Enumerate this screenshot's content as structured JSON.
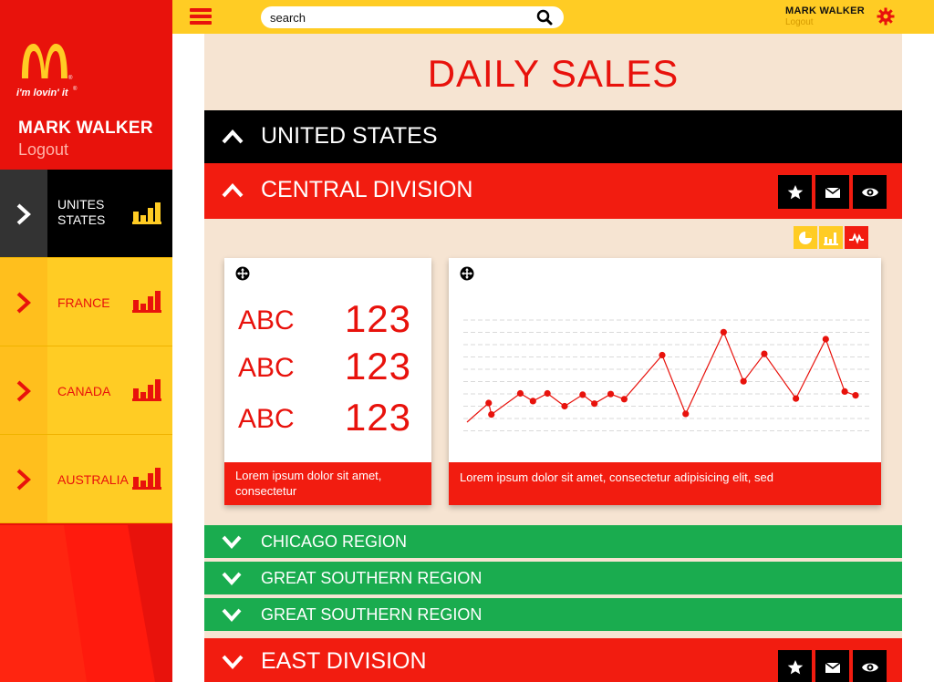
{
  "topbar": {
    "search_placeholder": "search",
    "user_name": "MARK WALKER",
    "logout": "Logout"
  },
  "sidebar": {
    "tagline": "i'm lovin' it®",
    "user_name": "MARK WALKER",
    "logout": "Logout",
    "items": [
      {
        "label_line1": "UNITES",
        "label_line2": "STATES",
        "active": true
      },
      {
        "label": "FRANCE"
      },
      {
        "label": "CANADA"
      },
      {
        "label": "AUSTRALIA"
      }
    ]
  },
  "main": {
    "title": "DAILY SALES",
    "rows": {
      "us": "UNITED STATES",
      "central": "CENTRAL DIVISION",
      "green": [
        "CHICAGO REGION",
        "GREAT SOUTHERN REGION",
        "GREAT SOUTHERN REGION"
      ],
      "east": "EAST DIVISION"
    },
    "kpis": [
      {
        "label": "ABC",
        "value": "123"
      },
      {
        "label": "ABC",
        "value": "123"
      },
      {
        "label": "ABC",
        "value": "123"
      }
    ],
    "kpi_footer": "Lorem ipsum dolor sit amet, consectetur",
    "chart_footer": "Lorem ipsum dolor sit amet, consectetur adipisicing elit, sed"
  },
  "colors": {
    "brand_red": "#e8120c",
    "brand_yellow": "#ffcc24",
    "region_green": "#1aac4f",
    "panel_bg": "#f6e4d2"
  },
  "icons": {
    "menu": "hamburger-icon",
    "search": "search-icon",
    "settings": "gear-icon",
    "row_actions": [
      "star-icon",
      "mail-icon",
      "eye-icon"
    ],
    "chart_types": [
      "pie-chart-icon",
      "bar-chart-icon",
      "line-chart-icon"
    ]
  },
  "chart_data": {
    "type": "line",
    "values": [
      2,
      5,
      3.2,
      6.5,
      5.3,
      6.5,
      4.5,
      6.3,
      4.9,
      6.4,
      5.6,
      12.5,
      3.3,
      16.1,
      8.4,
      12.7,
      5.7,
      15,
      6.8,
      6.2
    ],
    "ylim": [
      0,
      20
    ],
    "grid": true
  }
}
